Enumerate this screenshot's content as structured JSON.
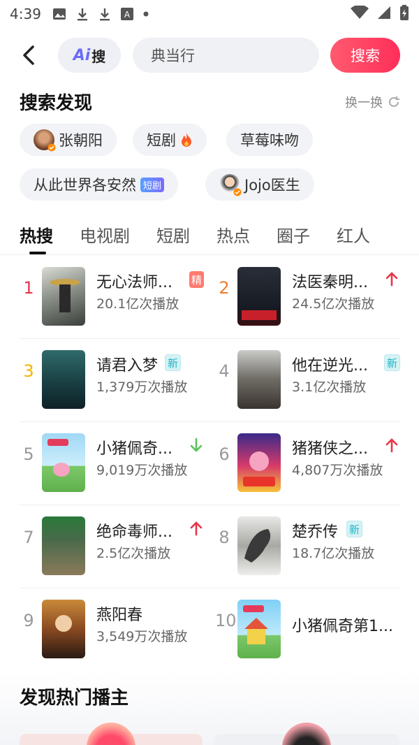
{
  "status_bar": {
    "time": "4:39"
  },
  "search": {
    "ai_label": "Ai",
    "ai_suffix": "搜",
    "query": "典当行",
    "button": "搜索"
  },
  "discovery": {
    "title": "搜索发现",
    "refresh": "换一换",
    "chips": [
      {
        "label": "张朝阳",
        "has_avatar": true
      },
      {
        "label": "短剧",
        "icon": "fire-icon"
      },
      {
        "label": "草莓味吻"
      },
      {
        "label": "从此世界各安然",
        "badge": "短剧"
      },
      {
        "label": "Jojo医生",
        "has_avatar": true
      }
    ]
  },
  "tabs": [
    "热搜",
    "电视剧",
    "短剧",
    "热点",
    "圈子",
    "红人"
  ],
  "ranking": [
    {
      "rank": "1",
      "title": "无心法师...",
      "plays": "20.1亿次播放",
      "tag": "精",
      "trend": "up"
    },
    {
      "rank": "2",
      "title": "法医秦明...",
      "plays": "24.5亿次播放",
      "trend": "up"
    },
    {
      "rank": "3",
      "title": "请君入梦",
      "plays": "1,379万次播放",
      "tag": "新"
    },
    {
      "rank": "4",
      "title": "他在逆光...",
      "plays": "3.1亿次播放",
      "tag": "新"
    },
    {
      "rank": "5",
      "title": "小猪佩奇...",
      "plays": "9,019万次播放",
      "trend": "down"
    },
    {
      "rank": "6",
      "title": "猪猪侠之...",
      "plays": "4,807万次播放",
      "trend": "up"
    },
    {
      "rank": "7",
      "title": "绝命毒师...",
      "plays": "2.5亿次播放",
      "trend": "up"
    },
    {
      "rank": "8",
      "title": "楚乔传",
      "plays": "18.7亿次播放",
      "tag": "新"
    },
    {
      "rank": "9",
      "title": "燕阳春",
      "plays": "3,549万次播放"
    },
    {
      "rank": "10",
      "title": "小猪佩奇第1..."
    }
  ],
  "colors": {
    "rank1": "#e8344a",
    "rank2": "#f07a2a",
    "rank3": "#f4b400",
    "rank_other": "#999999",
    "trend_up": "#e8344a",
    "trend_down": "#5cc35a",
    "accent": "#ff3b5c"
  },
  "hot_hosts": {
    "title": "发现热门播主"
  }
}
